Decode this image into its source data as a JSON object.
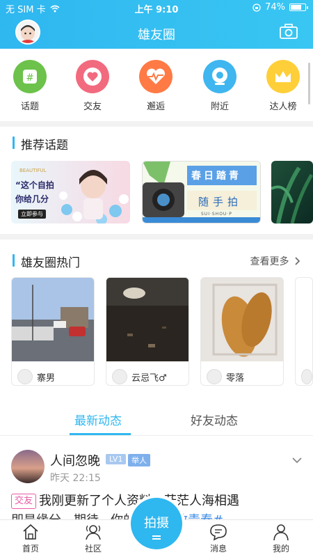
{
  "status_bar": {
    "carrier": "无 SIM 卡",
    "time": "上午 9:10",
    "battery": "74%"
  },
  "header": {
    "title": "雄友圈"
  },
  "categories": [
    {
      "label": "话题",
      "icon": "hashtag-icon",
      "color": "#6cc24a"
    },
    {
      "label": "交友",
      "icon": "heart-icon",
      "color": "#f26a7e"
    },
    {
      "label": "邂逅",
      "icon": "heartbeat-icon",
      "color": "#ff7a45"
    },
    {
      "label": "附近",
      "icon": "location-icon",
      "color": "#3fb6ef"
    },
    {
      "label": "达人榜",
      "icon": "crown-icon",
      "color": "#ffcf3a"
    }
  ],
  "recommended": {
    "title": "推荐话题",
    "cards": [
      {
        "text1": "“这个自拍",
        "text2": "你给几分",
        "text3": "立即参与",
        "text4": "BEAUTIFUL"
      },
      {
        "text1": "春日踏青",
        "text2": "随手拍",
        "text3": "SUI·SHOU·P"
      },
      {
        "text1": ""
      }
    ]
  },
  "hot": {
    "title": "雄友圈热门",
    "more": "查看更多",
    "items": [
      {
        "user": "寨男"
      },
      {
        "user": "云忌飞♂"
      },
      {
        "user": "零落"
      },
      {
        "user": ""
      }
    ]
  },
  "tabs": {
    "active": "最新动态",
    "other": "好友动态"
  },
  "post": {
    "name": "人间忽晚",
    "level": "LV1",
    "role": "举人",
    "time": "昨天 22:15",
    "tag": "交友",
    "text": "我刚更新了个人资料，茫茫人海相遇",
    "text2": "即是缘分，期待...你的碰面",
    "hashtag": "#致青春#"
  },
  "bottom_nav": {
    "home": "首页",
    "community": "社区",
    "shoot": "拍摄",
    "messages": "消息",
    "mine": "我的"
  }
}
